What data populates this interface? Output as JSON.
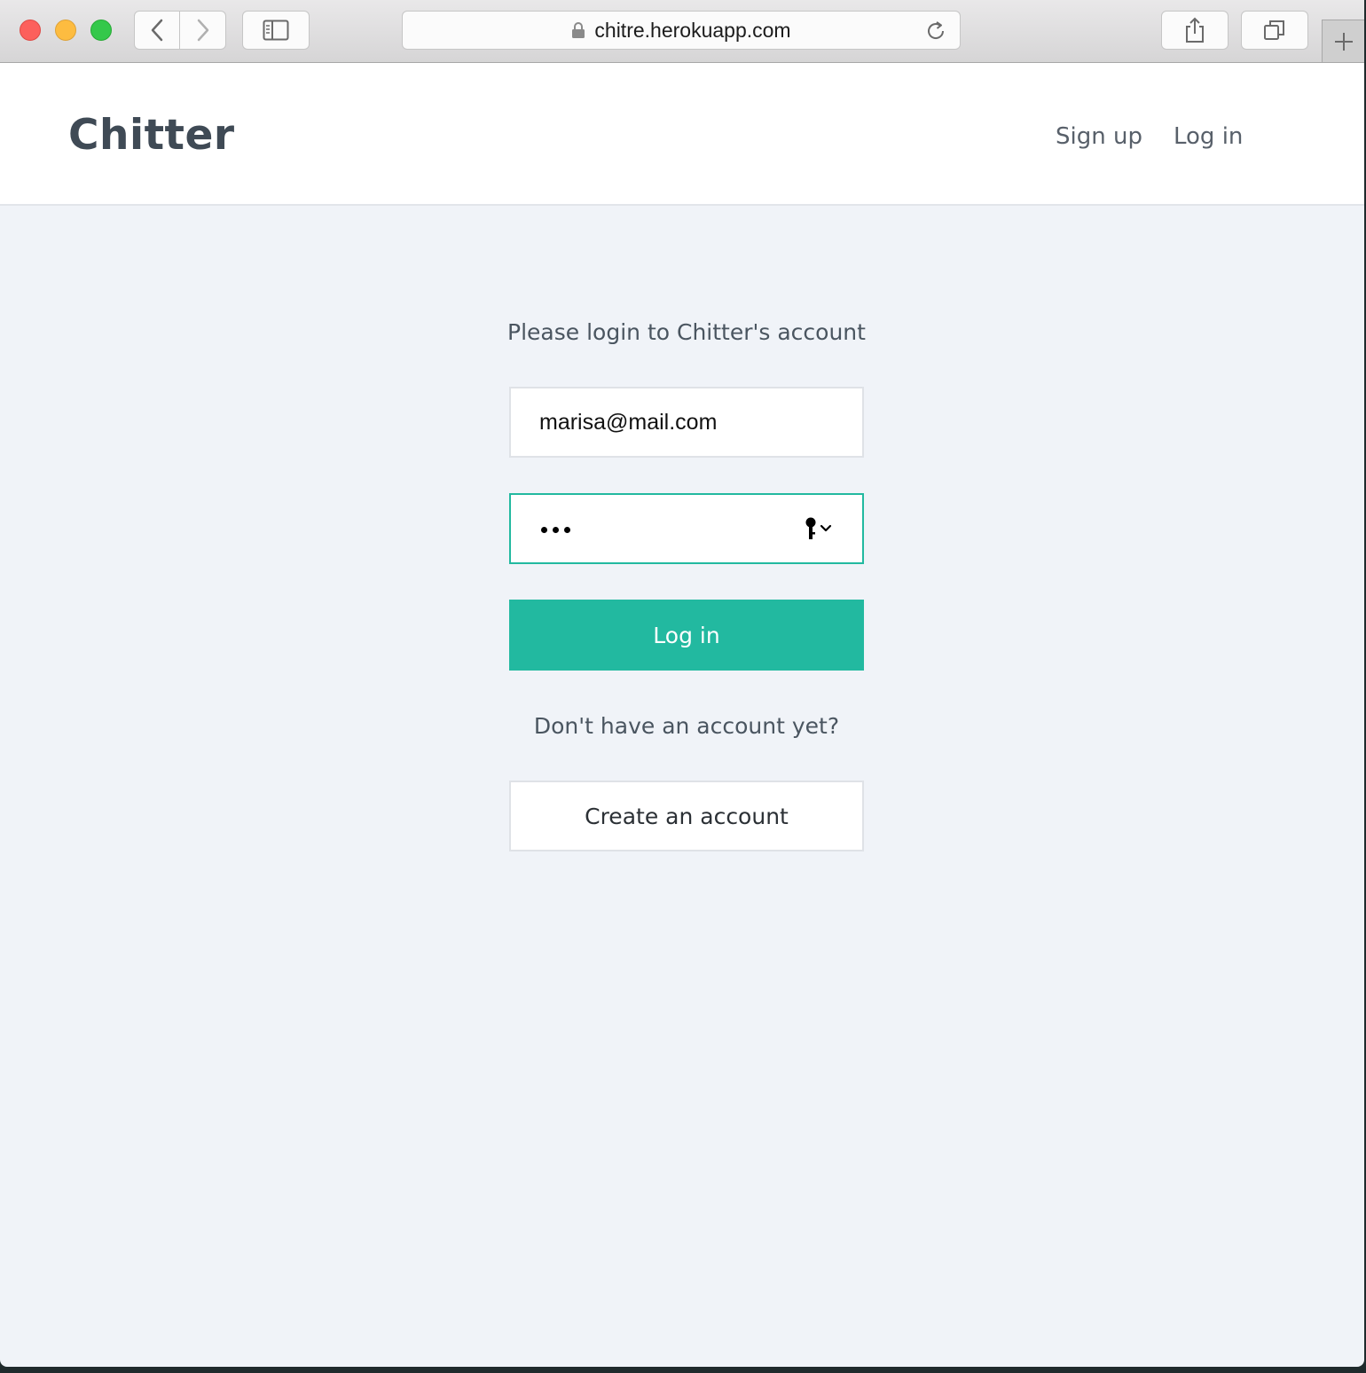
{
  "browser": {
    "url": "chitre.herokuapp.com",
    "icons": {
      "back": "chevron-left-icon",
      "forward": "chevron-right-icon",
      "sidebar": "sidebar-icon",
      "lock": "lock-icon",
      "reload": "reload-icon",
      "share": "share-icon",
      "tabs": "tabs-icon",
      "new_tab": "plus-icon"
    }
  },
  "header": {
    "brand": "Chitter",
    "nav": {
      "signup": "Sign up",
      "login": "Log in"
    }
  },
  "login_form": {
    "prompt": "Please login to Chitter's account",
    "email_value": "marisa@mail.com",
    "password_masked": "•••",
    "submit_label": "Log in",
    "no_account_text": "Don't have an account yet?",
    "create_account_label": "Create an account"
  },
  "colors": {
    "accent": "#22b9a0",
    "page_background": "#f0f3f8",
    "brand_text": "#3f4a55"
  }
}
